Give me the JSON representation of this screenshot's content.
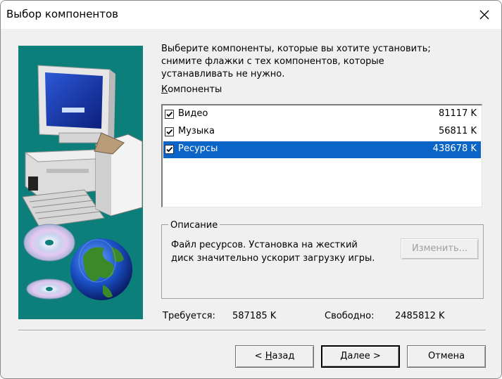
{
  "window": {
    "title": "Выбор компонентов"
  },
  "intro": {
    "lines": [
      "Выберите компоненты, которые вы хотите установить;",
      "снимите флажки с тех компонентов, которые",
      "устанавливать не нужно."
    ]
  },
  "components": {
    "label_accel": "К",
    "label_rest": "омпоненты",
    "items": [
      {
        "name": "Видео",
        "size": "81117 K",
        "checked": true,
        "selected": false
      },
      {
        "name": "Музыка",
        "size": "56811 K",
        "checked": true,
        "selected": false
      },
      {
        "name": "Ресурсы",
        "size": "438678 K",
        "checked": true,
        "selected": true
      }
    ]
  },
  "description": {
    "legend": "Описание",
    "lines": [
      "Файл ресурсов. Установка на жесткий",
      "диск значительно ускорит загрузку игры."
    ],
    "change_button": "Изменить..."
  },
  "disk": {
    "required_label": "Требуется:",
    "required_value": "587185 K",
    "free_label": "Свободно:",
    "free_value": "2485812 K"
  },
  "buttons": {
    "back_prefix": "< ",
    "back_accel": "Н",
    "back_rest": "азад",
    "next_accel": "Д",
    "next_rest": "алее >",
    "cancel": "Отмена"
  },
  "colors": {
    "selection": "#0a65c7",
    "art_background": "#0c7f7a"
  }
}
